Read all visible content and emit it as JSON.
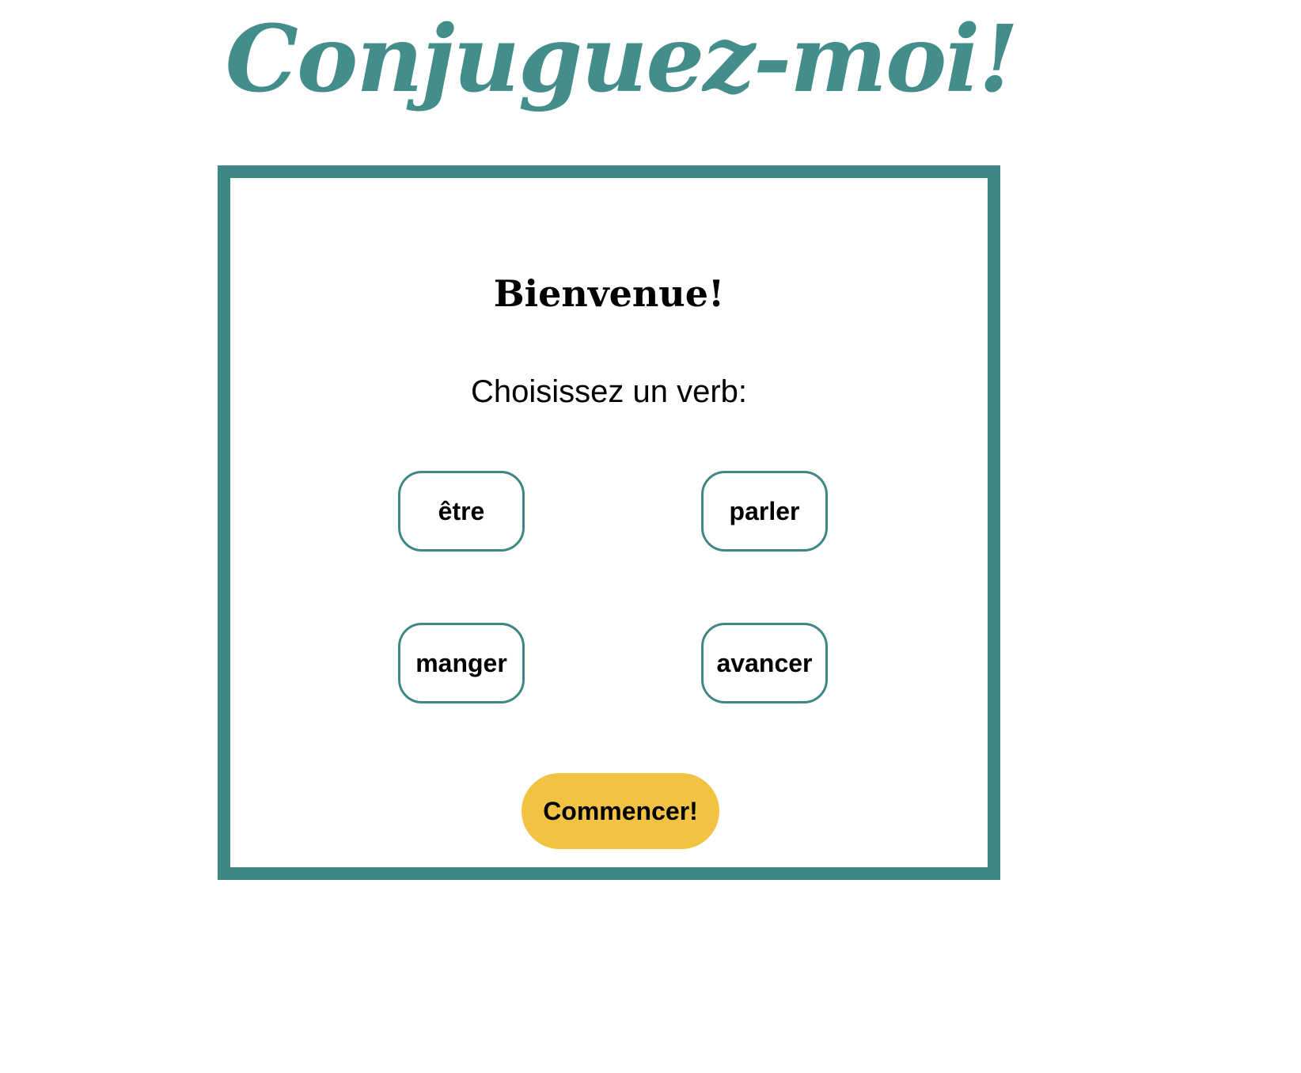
{
  "header": {
    "title": "Conjuguez-moi!"
  },
  "card": {
    "welcome": "Bienvenue!",
    "prompt": "Choisissez un verb:",
    "verbs": [
      "être",
      "parler",
      "manger",
      "avancer"
    ],
    "start_label": "Commencer!"
  },
  "colors": {
    "accent": "#3f8784",
    "title": "#438e8b",
    "start_button": "#f2c342"
  }
}
